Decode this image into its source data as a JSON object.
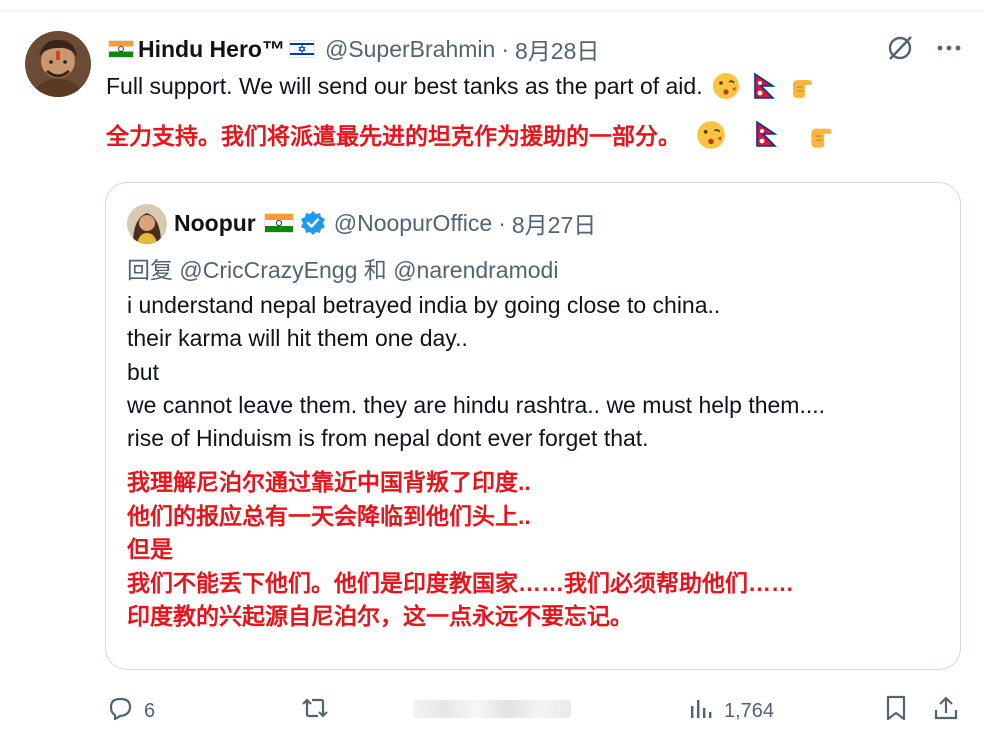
{
  "tweet": {
    "display_name": "Hindu Hero™",
    "handle": "@SuperBrahmin",
    "separator": "·",
    "date": "8月28日",
    "text": "Full support. We will send our best tanks as the part of aid.",
    "translation": "全力支持。我们将派遣最先进的坦克作为援助的一部分。",
    "emoji_icons": [
      "kiss-face-emoji",
      "nepal-flag-emoji",
      "pointing-hand-emoji"
    ]
  },
  "quote": {
    "display_name": "Noopur",
    "handle": "@NoopurOffice",
    "separator": "·",
    "date": "8月27日",
    "reply_prefix": "回复",
    "reply_user1": "@CricCrazyEngg",
    "reply_and": "和",
    "reply_user2": "@narendramodi",
    "body_lines": [
      "i understand nepal betrayed india  by going close to china..",
      "their karma will hit them one day..",
      "but",
      "we cannot leave them.  they are hindu rashtra.. we must help them....",
      "rise of Hinduism is from nepal dont ever forget that."
    ],
    "translation_lines": [
      "我理解尼泊尔通过靠近中国背叛了印度..",
      "他们的报应总有一天会降临到他们头上..",
      "但是",
      "我们不能丢下他们。他们是印度教国家……我们必须帮助他们……",
      "印度教的兴起源自尼泊尔，这一点永远不要忘记。"
    ]
  },
  "actions": {
    "reply_count": "6",
    "views_count": "1,764"
  },
  "colors": {
    "accent": "#1d9bf0",
    "muted": "#536471",
    "translation_red": "#e8131b"
  }
}
